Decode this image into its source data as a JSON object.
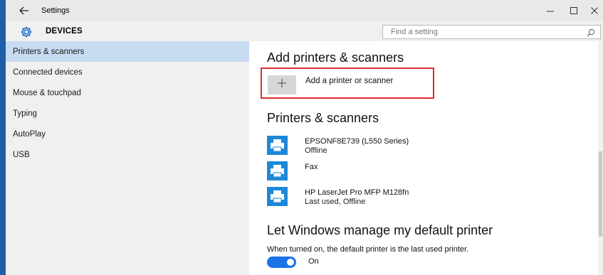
{
  "window": {
    "title": "Settings",
    "controls": {
      "minimize": "minimize",
      "maximize": "maximize",
      "close": "close"
    }
  },
  "header": {
    "title": "DEVICES",
    "search": {
      "placeholder": "Find a setting",
      "value": ""
    }
  },
  "sidebar": {
    "items": [
      {
        "label": "Printers & scanners",
        "active": true
      },
      {
        "label": "Connected devices",
        "active": false
      },
      {
        "label": "Mouse & touchpad",
        "active": false
      },
      {
        "label": "Typing",
        "active": false
      },
      {
        "label": "AutoPlay",
        "active": false
      },
      {
        "label": "USB",
        "active": false
      }
    ]
  },
  "main": {
    "add_section": {
      "heading": "Add printers & scanners",
      "add_button_label": "Add a printer or scanner"
    },
    "printers_section": {
      "heading": "Printers & scanners",
      "printers": [
        {
          "name": "EPSONF8E739 (L550 Series)",
          "status": "Offline"
        },
        {
          "name": "Fax",
          "status": ""
        },
        {
          "name": "HP LaserJet Pro MFP M128fn",
          "status": "Last used, Offline"
        }
      ]
    },
    "default_section": {
      "heading": "Let Windows manage my default printer",
      "description": "When turned on, the default printer is the last used printer.",
      "toggle_state": "On"
    }
  },
  "colors": {
    "accent": "#1e88d8",
    "sidebar_active": "#c7dbf1",
    "highlight_border": "#e02a2a",
    "toggle_on": "#1a73e8"
  },
  "icons": {
    "back": "back-arrow-icon",
    "gear": "gear-icon",
    "search": "search-icon",
    "plus": "plus-icon",
    "printer": "printer-icon"
  }
}
